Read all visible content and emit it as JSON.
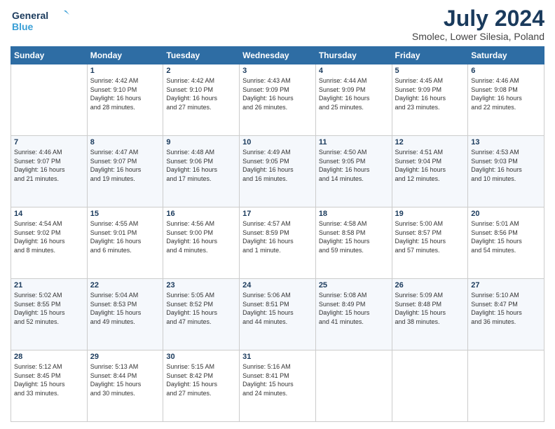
{
  "header": {
    "logo_line1": "General",
    "logo_line2": "Blue",
    "month": "July 2024",
    "location": "Smolec, Lower Silesia, Poland"
  },
  "weekdays": [
    "Sunday",
    "Monday",
    "Tuesday",
    "Wednesday",
    "Thursday",
    "Friday",
    "Saturday"
  ],
  "weeks": [
    [
      {
        "day": "",
        "info": ""
      },
      {
        "day": "1",
        "info": "Sunrise: 4:42 AM\nSunset: 9:10 PM\nDaylight: 16 hours\nand 28 minutes."
      },
      {
        "day": "2",
        "info": "Sunrise: 4:42 AM\nSunset: 9:10 PM\nDaylight: 16 hours\nand 27 minutes."
      },
      {
        "day": "3",
        "info": "Sunrise: 4:43 AM\nSunset: 9:09 PM\nDaylight: 16 hours\nand 26 minutes."
      },
      {
        "day": "4",
        "info": "Sunrise: 4:44 AM\nSunset: 9:09 PM\nDaylight: 16 hours\nand 25 minutes."
      },
      {
        "day": "5",
        "info": "Sunrise: 4:45 AM\nSunset: 9:09 PM\nDaylight: 16 hours\nand 23 minutes."
      },
      {
        "day": "6",
        "info": "Sunrise: 4:46 AM\nSunset: 9:08 PM\nDaylight: 16 hours\nand 22 minutes."
      }
    ],
    [
      {
        "day": "7",
        "info": "Sunrise: 4:46 AM\nSunset: 9:07 PM\nDaylight: 16 hours\nand 21 minutes."
      },
      {
        "day": "8",
        "info": "Sunrise: 4:47 AM\nSunset: 9:07 PM\nDaylight: 16 hours\nand 19 minutes."
      },
      {
        "day": "9",
        "info": "Sunrise: 4:48 AM\nSunset: 9:06 PM\nDaylight: 16 hours\nand 17 minutes."
      },
      {
        "day": "10",
        "info": "Sunrise: 4:49 AM\nSunset: 9:05 PM\nDaylight: 16 hours\nand 16 minutes."
      },
      {
        "day": "11",
        "info": "Sunrise: 4:50 AM\nSunset: 9:05 PM\nDaylight: 16 hours\nand 14 minutes."
      },
      {
        "day": "12",
        "info": "Sunrise: 4:51 AM\nSunset: 9:04 PM\nDaylight: 16 hours\nand 12 minutes."
      },
      {
        "day": "13",
        "info": "Sunrise: 4:53 AM\nSunset: 9:03 PM\nDaylight: 16 hours\nand 10 minutes."
      }
    ],
    [
      {
        "day": "14",
        "info": "Sunrise: 4:54 AM\nSunset: 9:02 PM\nDaylight: 16 hours\nand 8 minutes."
      },
      {
        "day": "15",
        "info": "Sunrise: 4:55 AM\nSunset: 9:01 PM\nDaylight: 16 hours\nand 6 minutes."
      },
      {
        "day": "16",
        "info": "Sunrise: 4:56 AM\nSunset: 9:00 PM\nDaylight: 16 hours\nand 4 minutes."
      },
      {
        "day": "17",
        "info": "Sunrise: 4:57 AM\nSunset: 8:59 PM\nDaylight: 16 hours\nand 1 minute."
      },
      {
        "day": "18",
        "info": "Sunrise: 4:58 AM\nSunset: 8:58 PM\nDaylight: 15 hours\nand 59 minutes."
      },
      {
        "day": "19",
        "info": "Sunrise: 5:00 AM\nSunset: 8:57 PM\nDaylight: 15 hours\nand 57 minutes."
      },
      {
        "day": "20",
        "info": "Sunrise: 5:01 AM\nSunset: 8:56 PM\nDaylight: 15 hours\nand 54 minutes."
      }
    ],
    [
      {
        "day": "21",
        "info": "Sunrise: 5:02 AM\nSunset: 8:55 PM\nDaylight: 15 hours\nand 52 minutes."
      },
      {
        "day": "22",
        "info": "Sunrise: 5:04 AM\nSunset: 8:53 PM\nDaylight: 15 hours\nand 49 minutes."
      },
      {
        "day": "23",
        "info": "Sunrise: 5:05 AM\nSunset: 8:52 PM\nDaylight: 15 hours\nand 47 minutes."
      },
      {
        "day": "24",
        "info": "Sunrise: 5:06 AM\nSunset: 8:51 PM\nDaylight: 15 hours\nand 44 minutes."
      },
      {
        "day": "25",
        "info": "Sunrise: 5:08 AM\nSunset: 8:49 PM\nDaylight: 15 hours\nand 41 minutes."
      },
      {
        "day": "26",
        "info": "Sunrise: 5:09 AM\nSunset: 8:48 PM\nDaylight: 15 hours\nand 38 minutes."
      },
      {
        "day": "27",
        "info": "Sunrise: 5:10 AM\nSunset: 8:47 PM\nDaylight: 15 hours\nand 36 minutes."
      }
    ],
    [
      {
        "day": "28",
        "info": "Sunrise: 5:12 AM\nSunset: 8:45 PM\nDaylight: 15 hours\nand 33 minutes."
      },
      {
        "day": "29",
        "info": "Sunrise: 5:13 AM\nSunset: 8:44 PM\nDaylight: 15 hours\nand 30 minutes."
      },
      {
        "day": "30",
        "info": "Sunrise: 5:15 AM\nSunset: 8:42 PM\nDaylight: 15 hours\nand 27 minutes."
      },
      {
        "day": "31",
        "info": "Sunrise: 5:16 AM\nSunset: 8:41 PM\nDaylight: 15 hours\nand 24 minutes."
      },
      {
        "day": "",
        "info": ""
      },
      {
        "day": "",
        "info": ""
      },
      {
        "day": "",
        "info": ""
      }
    ]
  ]
}
